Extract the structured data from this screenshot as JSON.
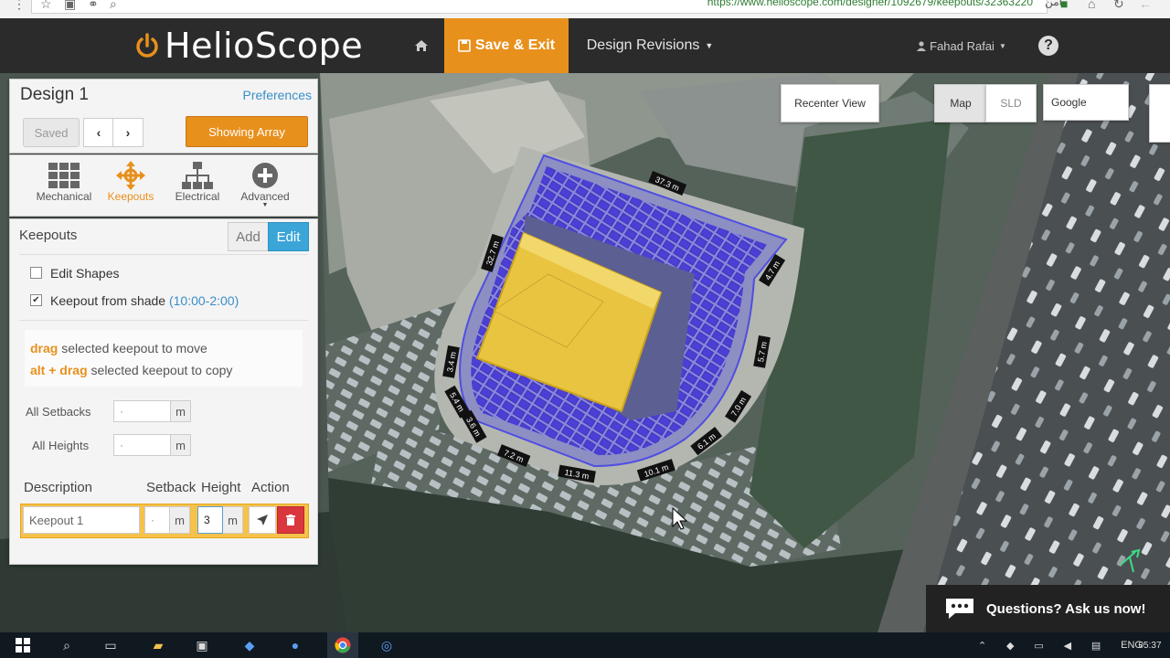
{
  "browser": {
    "url": "https://www.helioscope.com/designer/1092679/keepouts/32363220",
    "secure_label": "آمن"
  },
  "header": {
    "logo_text": "HelioScope",
    "save_label": "Save & Exit",
    "revisions_label": "Design Revisions",
    "user_name": "Fahad Rafai",
    "help_label": "?",
    "accent_color": "#e8901c"
  },
  "design_panel": {
    "title": "Design 1",
    "preferences_label": "Preferences",
    "saved_label": "Saved",
    "prev_label": "‹",
    "next_label": "›",
    "showing_label": "Showing Array"
  },
  "tools": {
    "items": [
      {
        "label": "Mechanical",
        "icon": "grid-icon"
      },
      {
        "label": "Keepouts",
        "icon": "move-icon"
      },
      {
        "label": "Electrical",
        "icon": "hierarchy-icon"
      },
      {
        "label": "Advanced",
        "icon": "plus-circle-icon"
      }
    ],
    "active": "Keepouts"
  },
  "keepouts": {
    "title": "Keepouts",
    "add_label": "Add",
    "edit_label": "Edit",
    "edit_shapes_label": "Edit Shapes",
    "edit_shapes_checked": false,
    "shade_label": "Keepout from shade",
    "shade_time": "(10:00-2:00)",
    "shade_checked": true,
    "hint1_key": "drag",
    "hint1_text": "selected keepout to move",
    "hint2_key": "alt + drag",
    "hint2_text": "selected keepout to copy",
    "all_setbacks_label": "All Setbacks",
    "all_setbacks_value": "·",
    "all_heights_label": "All Heights",
    "all_heights_value": "·",
    "unit": "m",
    "col_description": "Description",
    "col_setback": "Setback",
    "col_height": "Height",
    "col_action": "Action",
    "row": {
      "description": "Keepout 1",
      "setback": "·",
      "height": "3"
    }
  },
  "map_controls": {
    "recenter_label": "Recenter View",
    "map_label": "Map",
    "sld_label": "SLD",
    "google_label": "Google"
  },
  "dimensions": [
    "37.3 m",
    "32.7 m",
    "4.7 m",
    "5.7 m",
    "7.0 m",
    "6.1 m",
    "10.1 m",
    "11.3 m",
    "7.2 m",
    "3.6 m",
    "5.4 m",
    "3.4 m"
  ],
  "chat": {
    "label": "Questions? Ask us now!"
  },
  "taskbar": {
    "lang": "ENG",
    "time": "05:37"
  }
}
